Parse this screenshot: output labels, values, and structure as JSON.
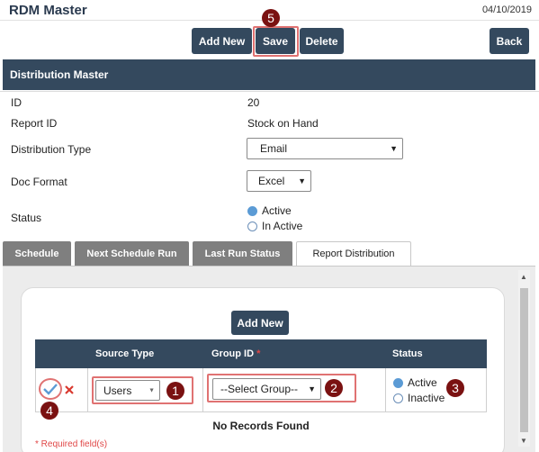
{
  "app": {
    "title": "RDM Master",
    "date": "04/10/2019"
  },
  "toolbar": {
    "add_new": "Add New",
    "save": "Save",
    "delete": "Delete",
    "back": "Back"
  },
  "markers": [
    "5",
    "1",
    "2",
    "3",
    "4"
  ],
  "panel": {
    "title": "Distribution Master",
    "fields": {
      "id_label": "ID",
      "id_value": "20",
      "report_label": "Report ID",
      "report_value": "Stock on Hand",
      "dist_type_label": "Distribution Type",
      "dist_type_value": "Email",
      "doc_format_label": "Doc Format",
      "doc_format_value": "Excel",
      "status_label": "Status",
      "status_active": "Active",
      "status_inactive": "In Active"
    }
  },
  "tabs": [
    "Schedule",
    "Next Schedule Run",
    "Last Run Status",
    "Report Distribution"
  ],
  "distribution": {
    "add_new": "Add New",
    "headers": {
      "source_type": "Source Type",
      "group_id": "Group ID",
      "required_mark": "*",
      "status": "Status"
    },
    "row": {
      "source_type": "Users",
      "group_placeholder": "--Select Group--",
      "status_active": "Active",
      "status_inactive": "Inactive"
    },
    "no_records": "No Records Found",
    "required_note": "* Required field(s)"
  },
  "colors": {
    "primary": "#34495e",
    "tab_inactive": "#7f7f7f",
    "highlight": "#e07272",
    "marker": "#7a1111",
    "radio": "#5b9bd5"
  }
}
